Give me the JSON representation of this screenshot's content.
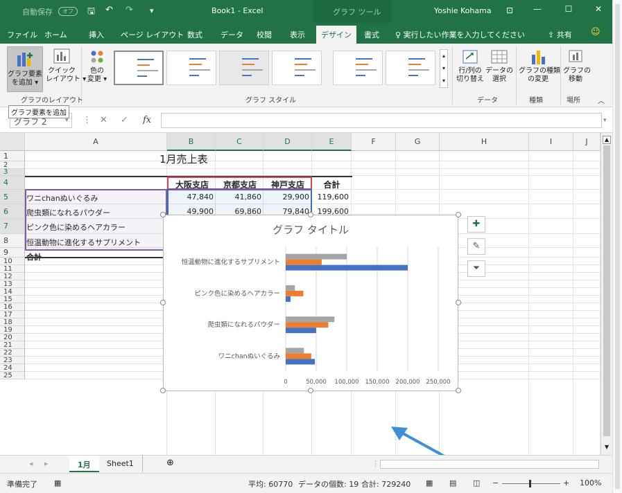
{
  "titlebar": {
    "autosave": "自動保存",
    "autosave_state": "オフ",
    "title": "Book1 - Excel",
    "contextual": "グラフ ツール",
    "user": "Yoshie Kohama"
  },
  "tabs": [
    "ファイル",
    "ホーム",
    "挿入",
    "ページ レイアウト",
    "数式",
    "データ",
    "校閲",
    "表示",
    "デザイン",
    "書式"
  ],
  "tell_me": "実行したい作業を入力してください",
  "share": "共有",
  "ribbon": {
    "add_element": [
      "グラフ要素",
      "を追加"
    ],
    "quick_layout": [
      "クイック",
      "レイアウト"
    ],
    "colors": [
      "色の",
      "変更"
    ],
    "switch_rowcol": [
      "行/列の",
      "切り替え"
    ],
    "select_data": [
      "データの",
      "選択"
    ],
    "change_type": [
      "グラフの種類",
      "の変更"
    ],
    "move_chart": [
      "グラフの",
      "移動"
    ],
    "group_layouts": "グラフのレイアウト",
    "group_styles": "グラフ スタイル",
    "group_data": "データ",
    "group_type": "種類",
    "group_location": "場所"
  },
  "tooltip": "グラフ要素を追加",
  "formula": {
    "namebox": "グラフ 2",
    "fx": "fx"
  },
  "columns": [
    "A",
    "B",
    "C",
    "D",
    "E",
    "F",
    "G",
    "H",
    "I",
    "J"
  ],
  "rows": [
    "1",
    "2",
    "3",
    "4",
    "5",
    "6",
    "7",
    "8",
    "9",
    "10",
    "11",
    "12",
    "13",
    "14",
    "15",
    "16",
    "17",
    "18",
    "19",
    "20",
    "21",
    "22",
    "23",
    "24",
    "25"
  ],
  "sheet": {
    "title": "1月売上表",
    "headers": [
      "大阪支店",
      "京都支店",
      "神戸支店",
      "合計"
    ],
    "items": [
      {
        "name": "ワニchanぬいぐるみ",
        "values": [
          "47,840",
          "41,860",
          "29,900",
          "119,600"
        ]
      },
      {
        "name": "爬虫類になれるパウダー",
        "values": [
          "49,900",
          "69,860",
          "79,840",
          "199,600"
        ]
      },
      {
        "name": "ピンク色に染めるヘアカラー",
        "values": []
      },
      {
        "name": "恒温動物に進化するサプリメント",
        "values": []
      }
    ],
    "total_label": "合計"
  },
  "chart_data": {
    "type": "bar",
    "orientation": "horizontal",
    "title": "グラフ タイトル",
    "categories": [
      "ワニchanぬいぐるみ",
      "爬虫類になれるパウダー",
      "ピンク色に染めるヘアカラー",
      "恒温動物に進化するサプリメント"
    ],
    "series": [
      {
        "color": "#4472c4",
        "values": [
          47840,
          49900,
          8000,
          200000
        ]
      },
      {
        "color": "#ed7d31",
        "values": [
          41860,
          69860,
          29000,
          59000
        ]
      },
      {
        "color": "#a5a5a5",
        "values": [
          29900,
          79840,
          15000,
          100000
        ]
      }
    ],
    "xlim": [
      0,
      250000
    ],
    "x_ticks": [
      "0",
      "50,000",
      "100,000",
      "150,000",
      "200,000",
      "250,000"
    ],
    "gridlines": true,
    "legend": "none"
  },
  "sheet_tabs": [
    "1月",
    "Sheet1"
  ],
  "status": {
    "ready": "準備完了",
    "average": "平均: 60770",
    "count": "データの個数: 19",
    "sum": "合計: 729240",
    "zoom": "100%"
  },
  "colors": {
    "excel_green": "#217346",
    "ribbon_bg": "#f3f3f3",
    "annotation_arrow": "#3f8fd6"
  }
}
